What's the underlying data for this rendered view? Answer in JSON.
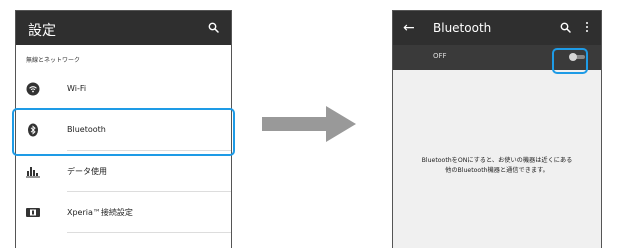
{
  "left_screen": {
    "title": "設定",
    "section_header": "無線とネットワーク",
    "items": [
      {
        "label": "Wi-Fi",
        "icon": "wifi-icon"
      },
      {
        "label": "Bluetooth",
        "icon": "bluetooth-icon"
      },
      {
        "label": "データ使用",
        "icon": "data-usage-icon"
      },
      {
        "label": "Xperia™接続設定",
        "icon": "xperia-connect-icon"
      }
    ]
  },
  "right_screen": {
    "title": "Bluetooth",
    "toggle_state_label": "OFF",
    "message_line1": "BluetoothをONにすると、お使いの機器は近くにある",
    "message_line2": "他のBluetooth機器と通信できます。"
  },
  "colors": {
    "appbar": "#2f2f2f",
    "highlight": "#1e9be6",
    "arrow": "#999999"
  }
}
